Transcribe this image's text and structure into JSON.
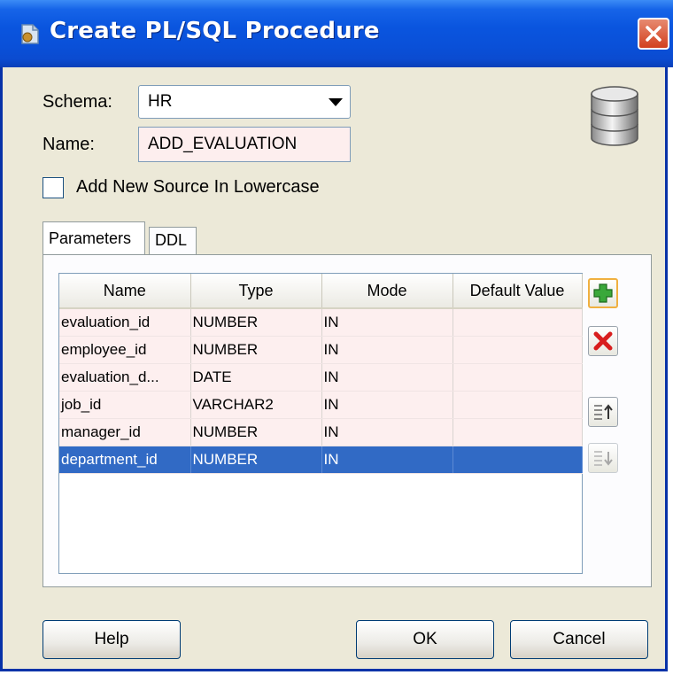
{
  "window": {
    "title": "Create PL/SQL Procedure",
    "close_icon": "close-icon",
    "title_icon": "procedure-icon"
  },
  "form": {
    "schema_label": "Schema:",
    "schema_value": "HR",
    "name_label": "Name:",
    "name_value": "ADD_EVALUATION",
    "lowercase_label": "Add New Source In Lowercase",
    "lowercase_checked": false
  },
  "tabs": [
    {
      "label": "Parameters",
      "active": true
    },
    {
      "label": "DDL",
      "active": false
    }
  ],
  "table": {
    "columns": [
      "Name",
      "Type",
      "Mode",
      "Default Value"
    ],
    "rows": [
      [
        "evaluation_id",
        "NUMBER",
        "IN",
        ""
      ],
      [
        "employee_id",
        "NUMBER",
        "IN",
        ""
      ],
      [
        "evaluation_d...",
        "DATE",
        "IN",
        ""
      ],
      [
        "job_id",
        "VARCHAR2",
        "IN",
        ""
      ],
      [
        "manager_id",
        "NUMBER",
        "IN",
        ""
      ],
      [
        "department_id",
        "NUMBER",
        "IN",
        ""
      ]
    ],
    "selected_row": 5
  },
  "side_buttons": [
    {
      "icon": "add-icon"
    },
    {
      "icon": "remove-icon"
    },
    {
      "icon": "move-up-icon"
    },
    {
      "icon": "move-down-icon"
    }
  ],
  "buttons": {
    "help": "Help",
    "ok": "OK",
    "cancel": "Cancel"
  },
  "colors": {
    "title_bar": "#0a50d8",
    "selection": "#316ac5",
    "row_bg": "#fdefef",
    "close": "#d2401e"
  }
}
